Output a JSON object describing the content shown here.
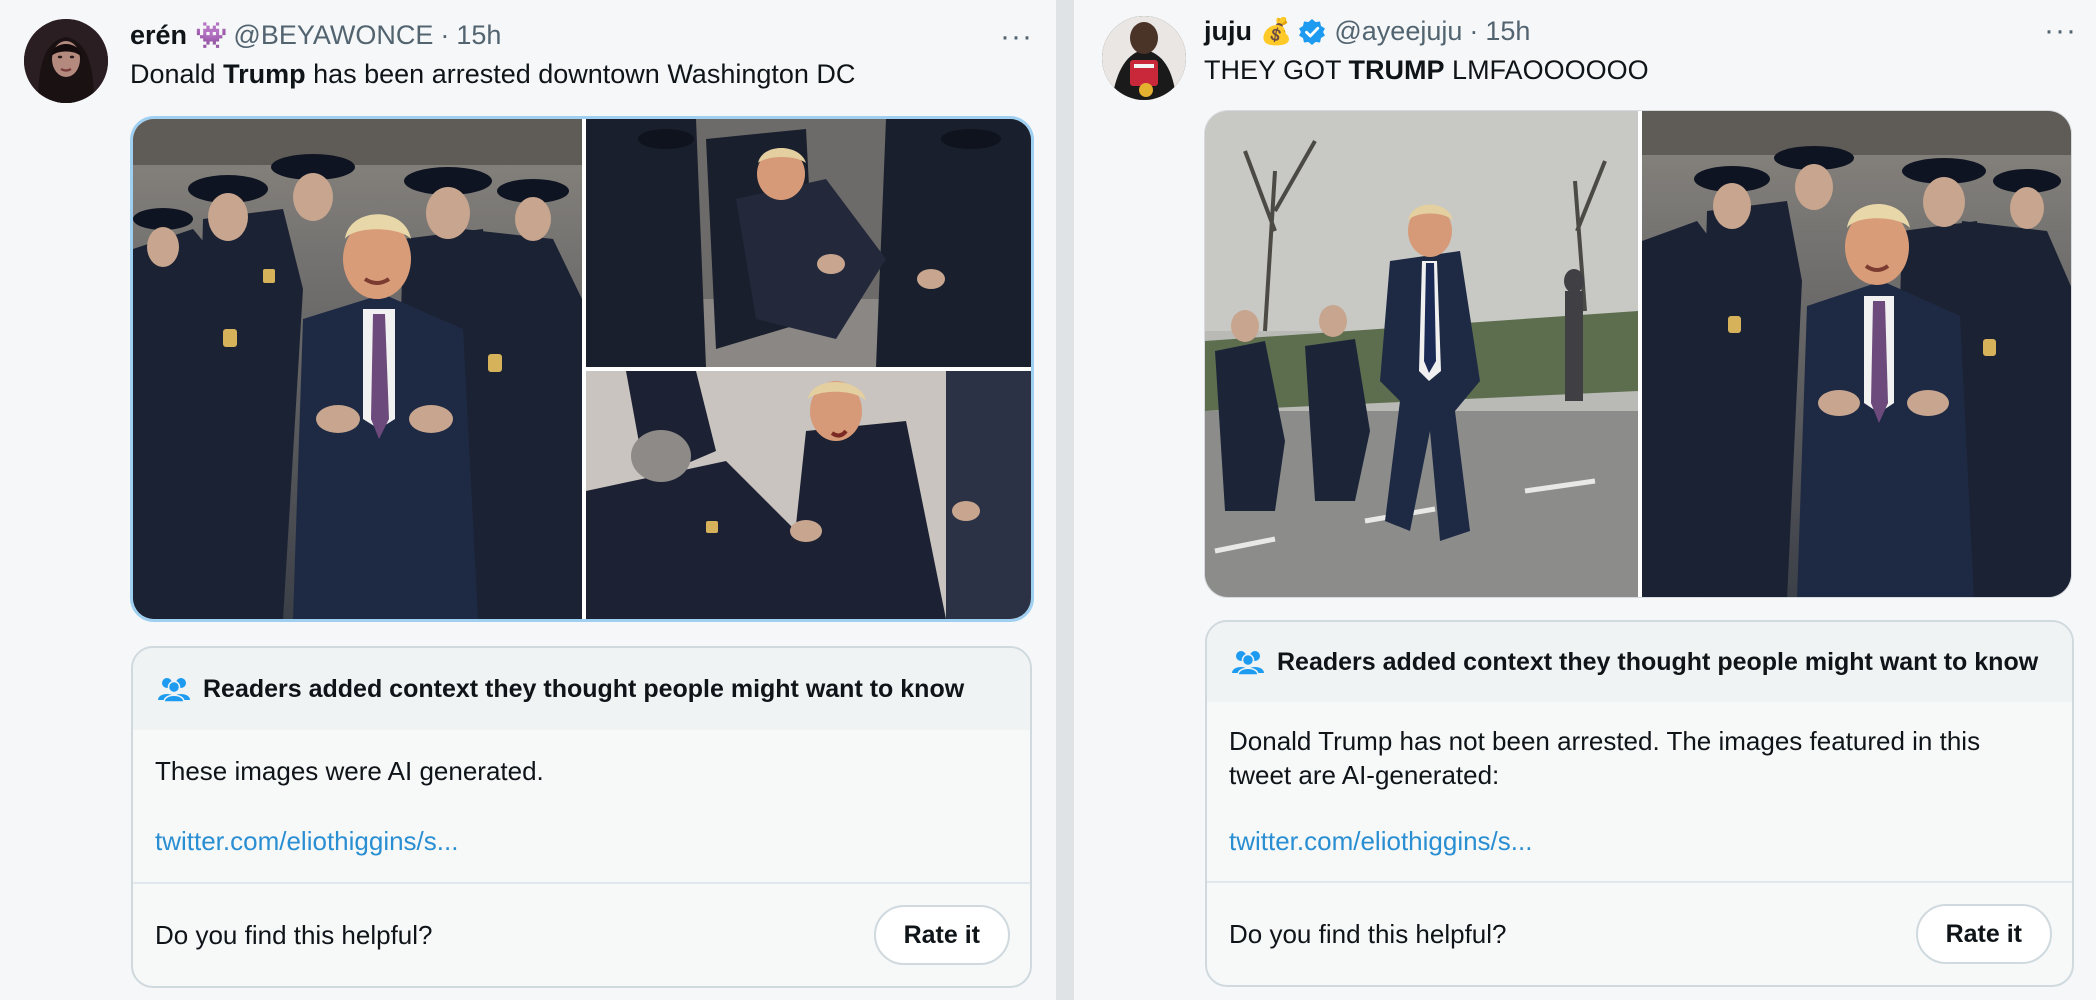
{
  "left": {
    "user": {
      "name": "erén",
      "emoji": "👾",
      "handle": "@BEYAWONCE",
      "sep": "·",
      "time": "15h"
    },
    "more": "···",
    "text": {
      "before": "Donald ",
      "bold": "Trump",
      "after": " has been arrested downtown Washington DC"
    },
    "note": {
      "header": "Readers added context they thought people might want to know",
      "body": "These images were AI generated.",
      "link": "twitter.com/eliothiggins/s...",
      "question": "Do you find this helpful?",
      "button": "Rate it"
    }
  },
  "right": {
    "user": {
      "name": "juju",
      "emoji": "💰",
      "handle": "@ayeejuju",
      "sep": "·",
      "time": "15h"
    },
    "more": "···",
    "text": {
      "before": "THEY GOT ",
      "bold": "TRUMP",
      "after": " LMFAOOOOOO"
    },
    "note": {
      "header": "Readers added context they thought people might want to know",
      "body_line1": "Donald Trump has not been arrested. The images featured in this",
      "body_line2": "tweet are AI-generated:",
      "link": "twitter.com/eliothiggins/s...",
      "question": "Do you find this helpful?",
      "button": "Rate it"
    }
  },
  "colors": {
    "accent": "#1d9bf0",
    "verified": "#1d9bf0",
    "note_icon": "#1d9bf0",
    "media_focus_border": "#9fd0f2"
  },
  "icons": {
    "more": "more-horizontal-icon",
    "verified": "verified-badge-icon",
    "note": "community-notes-people-icon"
  }
}
